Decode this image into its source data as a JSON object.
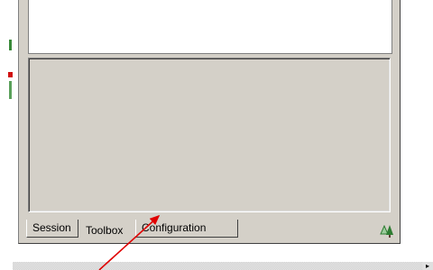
{
  "tabs": {
    "session": "Session",
    "toolbox": "Toolbox",
    "configuration": "Configuration"
  },
  "active_tab": "Toolbox",
  "icons": {
    "tray": "tree-icon",
    "scroll_right": "arrow-right-icon",
    "annotation": "arrow-annotation"
  },
  "colors": {
    "panel": "#d4d0c8",
    "annotation_arrow": "#e00000",
    "tree": "#2e7d32"
  },
  "scroll_arrow_glyph": "▸"
}
